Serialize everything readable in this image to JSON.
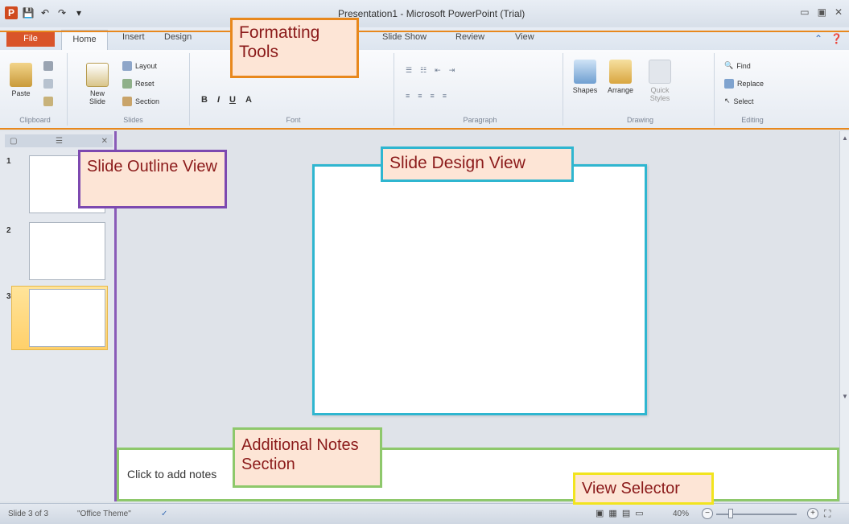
{
  "window": {
    "title": "Presentation1 - Microsoft PowerPoint (Trial)",
    "controls": [
      "▭",
      "▣",
      "✕"
    ]
  },
  "qat": {
    "logo": "P",
    "save": "💾",
    "undo": "↶",
    "redo": "↷",
    "customize": "▾"
  },
  "tabs": {
    "file": "File",
    "home": "Home",
    "insert": "Insert",
    "design": "Design",
    "slideshow": "Slide Show",
    "review": "Review",
    "view": "View"
  },
  "ribbon": {
    "clipboard": {
      "label": "Clipboard",
      "paste": "Paste"
    },
    "slides": {
      "label": "Slides",
      "new_slide": "New Slide",
      "layout": "Layout",
      "reset": "Reset",
      "section": "Section"
    },
    "font": {
      "label": "Font",
      "bold": "B",
      "italic": "I",
      "underline": "U",
      "font_size": "A"
    },
    "paragraph": {
      "label": "Paragraph"
    },
    "drawing": {
      "label": "Drawing",
      "shapes": "Shapes",
      "arrange": "Arrange",
      "quick_styles": "Quick Styles"
    },
    "editing": {
      "label": "Editing",
      "find": "Find",
      "replace": "Replace",
      "select": "Select"
    }
  },
  "thumbnails": {
    "pane_close": "✕",
    "items": [
      {
        "num": "1"
      },
      {
        "num": "2"
      },
      {
        "num": "3"
      }
    ]
  },
  "notes": {
    "placeholder": "Click to add notes"
  },
  "status": {
    "slide": "Slide 3 of 3",
    "theme": "\"Office Theme\"",
    "zoom": "40%",
    "zoom_out": "−",
    "zoom_in": "+"
  },
  "callouts": {
    "formatting_tools": "Formatting Tools",
    "slide_outline_view": "Slide Outline View",
    "slide_design_view": "Slide Design View",
    "additional_notes": "Additional Notes Section",
    "view_selector": "View Selector"
  },
  "colors": {
    "formatting_border": "#e8881d",
    "outline_border": "#7d49b0",
    "design_border": "#2fb6d0",
    "notes_border": "#8ec86b",
    "view_border": "#f2e41e",
    "callout_text": "#8b1a1a"
  }
}
